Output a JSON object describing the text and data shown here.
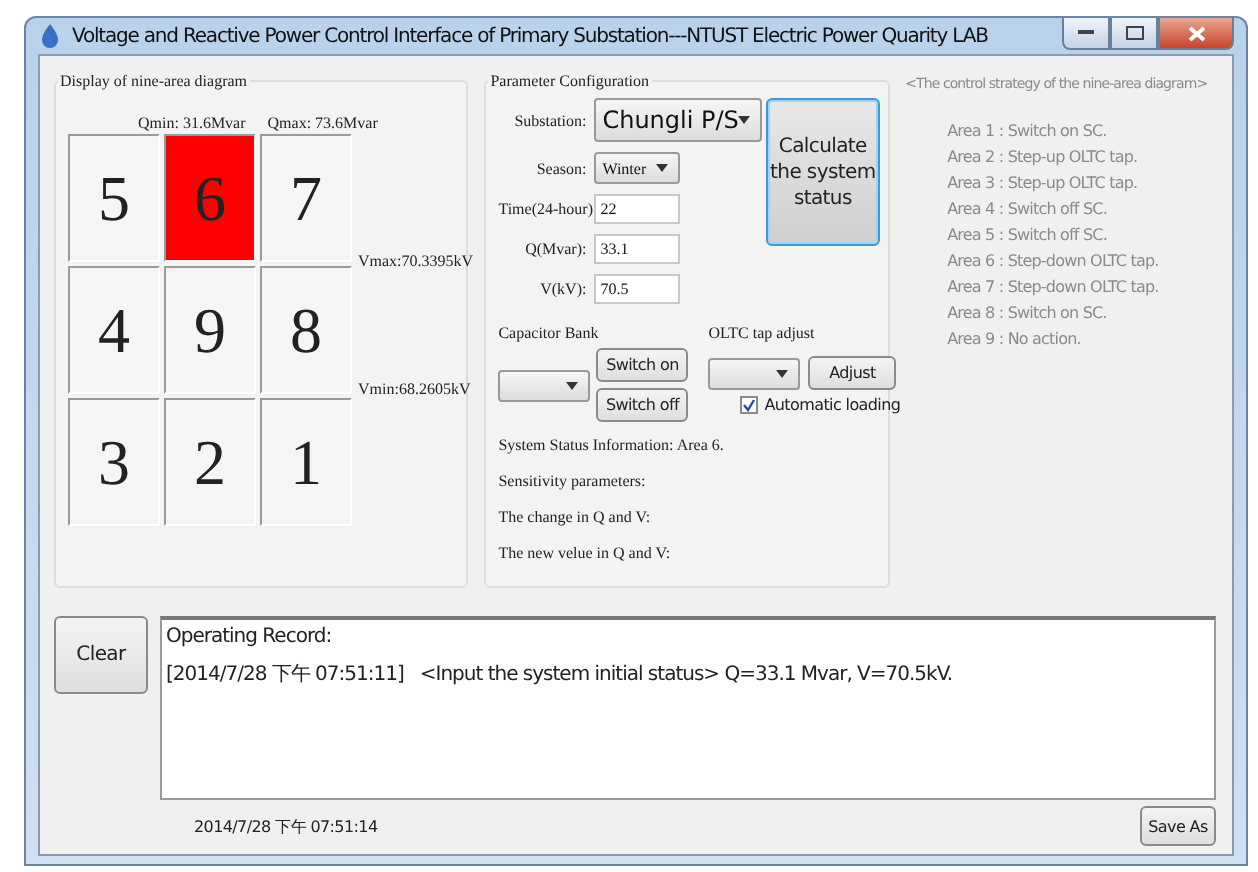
{
  "window": {
    "title": "Voltage and Reactive Power Control Interface of Primary Substation---NTUST Electric Power Quarity LAB"
  },
  "nine_area": {
    "title": "Display of nine-area diagram",
    "qmin": "Qmin:  31.6Mvar",
    "qmax": "Qmax:  73.6Mvar",
    "vmax": "Vmax:70.3395kV",
    "vmin": "Vmin:68.2605kV",
    "cells": [
      {
        "label": "5",
        "selected": false
      },
      {
        "label": "6",
        "selected": true
      },
      {
        "label": "7",
        "selected": false
      },
      {
        "label": "4",
        "selected": false
      },
      {
        "label": "9",
        "selected": false
      },
      {
        "label": "8",
        "selected": false
      },
      {
        "label": "3",
        "selected": false
      },
      {
        "label": "2",
        "selected": false
      },
      {
        "label": "1",
        "selected": false
      }
    ]
  },
  "parameters": {
    "title": "Parameter Configuration",
    "substation": {
      "label": "Substation:",
      "value": "Chungli P/S"
    },
    "season": {
      "label": "Season:",
      "value": "Winter"
    },
    "fields": [
      {
        "label": "Time(24-hour):",
        "value": "22"
      },
      {
        "label": "Q(Mvar):",
        "value": "33.1"
      },
      {
        "label": "V(kV):",
        "value": "70.5"
      }
    ],
    "calculate_button": "Calculate the system status",
    "capacitor_bank": {
      "label": "Capacitor Bank",
      "buttons": [
        "Switch on",
        "Switch off"
      ]
    },
    "oltc": {
      "label": "OLTC tap adjust",
      "button": "Adjust"
    },
    "automatic_loading": {
      "label": "Automatic loading",
      "checked": true
    },
    "status_lines": [
      "System Status Information: Area 6.",
      "Sensitivity parameters:",
      "The change in Q and V:",
      "The new velue in Q and V:"
    ]
  },
  "strategy": {
    "title": "<The control strategy of the nine-area diagram>",
    "items": [
      "Area 1 : Switch on SC.",
      "Area 2 : Step-up OLTC tap.",
      "Area 3 : Step-up OLTC tap.",
      "Area 4 : Switch off SC.",
      "Area 5 : Switch off SC.",
      "Area 6 : Step-down OLTC tap.",
      "Area 7 : Step-down OLTC tap.",
      "Area 8 : Switch on SC.",
      "Area 9 : No action."
    ]
  },
  "record": {
    "clear_button": "Clear",
    "lines": [
      "Operating Record:",
      "[2014/7/28 下午 07:51:11]   <Input the system initial status> Q=33.1 Mvar, V=70.5kV."
    ]
  },
  "status_bar": {
    "time": "2014/7/28 下午 07:51:14",
    "save_button": "Save As"
  }
}
